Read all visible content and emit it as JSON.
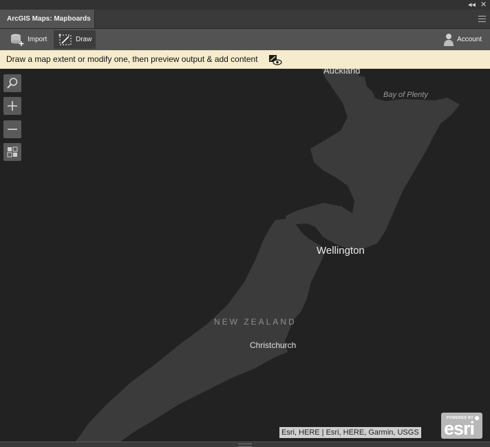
{
  "window": {
    "collapse_glyph": "◂◂",
    "close_glyph": "✕"
  },
  "tab": {
    "title": "ArcGIS Maps: Mapboards"
  },
  "toolbar": {
    "import_label": "Import",
    "draw_label": "Draw",
    "account_label": "Account"
  },
  "banner": {
    "message": "Draw a map extent or modify one, then preview output & add content"
  },
  "map": {
    "labels": {
      "auckland": "Auckland",
      "bay_of_plenty": "Bay of Plenty",
      "wellington": "Wellington",
      "new_zealand": "NEW ZEALAND",
      "christchurch": "Christchurch"
    },
    "attribution": "Esri, HERE | Esri, HERE, Garmin, USGS",
    "esri_badge": {
      "powered_by": "POWERED BY",
      "logo": "esri"
    },
    "colors": {
      "water": "#222222",
      "land": "#3b3b3b"
    }
  }
}
